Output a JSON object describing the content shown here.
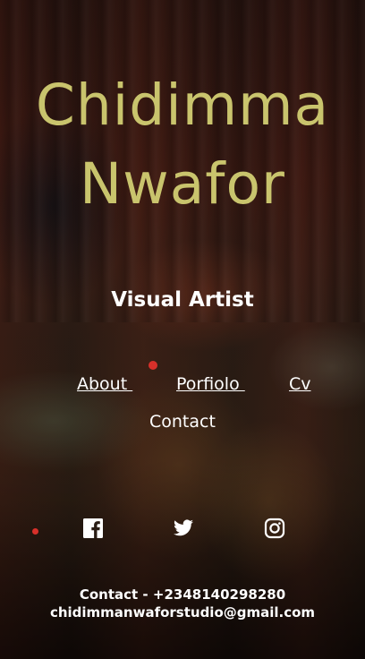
{
  "hero": {
    "name_line1": "Chidimma",
    "name_line2": "Nwafor",
    "tagline": "Visual Artist"
  },
  "nav": {
    "about": "About ",
    "portfolio": "Porfiolo ",
    "cv": "Cv",
    "contact": "Contact"
  },
  "social": {
    "facebook_icon": "facebook-icon",
    "twitter_icon": "twitter-icon",
    "instagram_icon": "instagram-icon"
  },
  "footer": {
    "contact_line": "Contact - +2348140298280",
    "email": "chidimmanwaforstudio@gmail.com"
  },
  "colors": {
    "name": "#c9c46d",
    "text": "#ffffff",
    "accent_dot": "#d8302a"
  }
}
